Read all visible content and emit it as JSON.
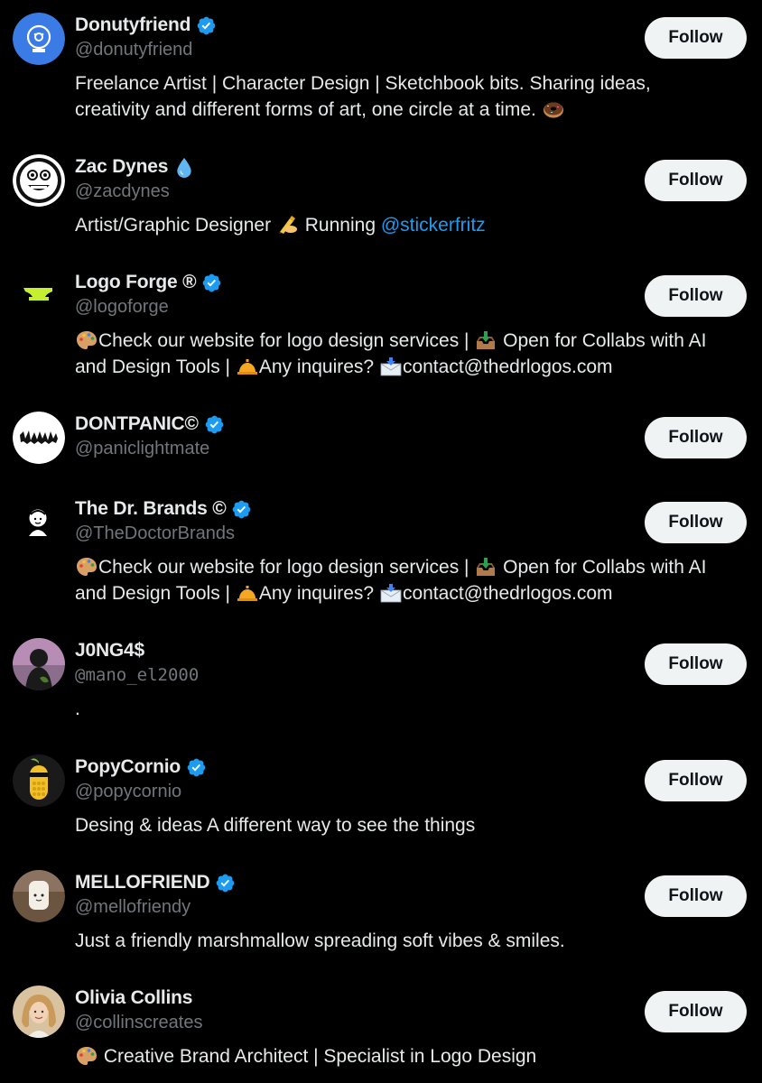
{
  "colors": {
    "background": "#000000",
    "primary_text": "#e7e9ea",
    "secondary_text": "#71767b",
    "link": "#1d9bf0",
    "verified": "#1d9bf0",
    "follow_button_bg": "#eff3f4",
    "follow_button_text": "#0f1419"
  },
  "users": [
    {
      "name": "Donutyfriend",
      "handle": "@donutyfriend",
      "verified": true,
      "bio_lines": [
        "Freelance Artist | Character Design | Sketchbook bits. Sharing ideas,",
        "creativity and different forms of art, one circle at a time."
      ],
      "bio_emoji": "donut-emoji",
      "follow_label": "Follow"
    },
    {
      "name": "Zac Dynes",
      "handle": "@zacdynes",
      "verified": false,
      "name_emoji": "droplet-emoji",
      "bio_part1": "Artist/Graphic Designer",
      "bio_emoji": "writing-hand-emoji",
      "bio_part2": "Running",
      "bio_mention": "@stickerfritz",
      "follow_label": "Follow"
    },
    {
      "name": "Logo Forge ®",
      "handle": "@logoforge",
      "verified": true,
      "bio_seg1": "Check our website for logo design services |",
      "bio_seg2": "Open for Collabs with AI",
      "bio_seg3": "and Design Tools |",
      "bio_seg4": "Any inquires?",
      "bio_seg5": "contact@thedrlogos.com",
      "emojis": [
        "palette-emoji",
        "inbox-tray-emoji",
        "bellhop-bell-emoji",
        "envelope-arrow-emoji"
      ],
      "follow_label": "Follow"
    },
    {
      "name": "DONTPANIC©",
      "handle": "@paniclightmate",
      "verified": true,
      "follow_label": "Follow"
    },
    {
      "name": "The Dr. Brands ©",
      "handle": "@TheDoctorBrands",
      "verified": true,
      "bio_seg1": "Check our website for logo design services |",
      "bio_seg2": "Open for Collabs with AI",
      "bio_seg3": "and Design Tools |",
      "bio_seg4": "Any inquires?",
      "bio_seg5": "contact@thedrlogos.com",
      "follow_label": "Follow"
    },
    {
      "name": "J0NG4$",
      "handle": "@mano_el2000",
      "verified": false,
      "bio": ".",
      "follow_label": "Follow"
    },
    {
      "name": "PopyCornio",
      "handle": "@popycornio",
      "verified": true,
      "bio": "Desing & ideas A different way to see the things",
      "follow_label": "Follow"
    },
    {
      "name": "MELLOFRIEND",
      "handle": "@mellofriendy",
      "verified": true,
      "bio": "Just a friendly marshmallow spreading soft vibes & smiles.",
      "follow_label": "Follow"
    },
    {
      "name": "Olivia Collins",
      "handle": "@collinscreates",
      "verified": false,
      "bio": "Creative Brand Architect | Specialist in Logo Design",
      "bio_emoji": "palette-emoji",
      "follow_label": "Follow"
    }
  ]
}
